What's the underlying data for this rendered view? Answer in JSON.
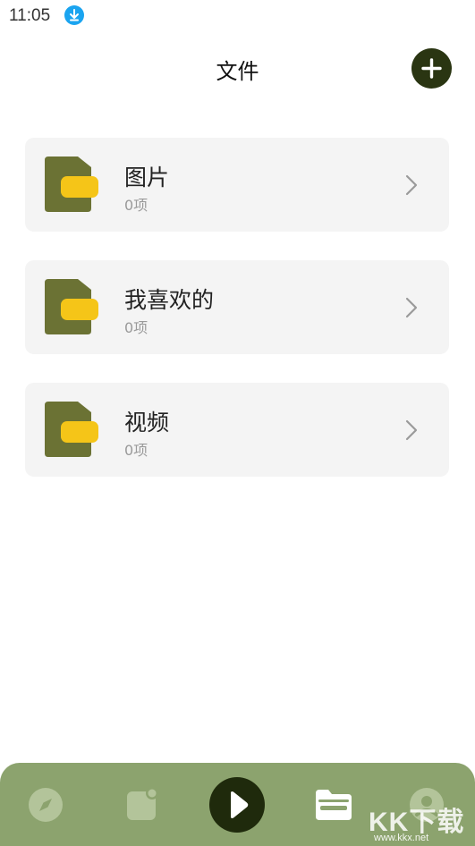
{
  "status_bar": {
    "time": "11:05",
    "download_icon": "download-arrow-icon"
  },
  "header": {
    "title": "文件",
    "add_icon": "plus-icon"
  },
  "folders": [
    {
      "name": "图片",
      "count": "0项",
      "icon": "folder-icon"
    },
    {
      "name": "我喜欢的",
      "count": "0项",
      "icon": "folder-icon"
    },
    {
      "name": "视频",
      "count": "0项",
      "icon": "folder-icon"
    }
  ],
  "bottom_nav": {
    "items": [
      "compass-icon",
      "photo-icon",
      "play-icon",
      "folder-icon",
      "profile-icon"
    ],
    "active": "folder-icon"
  },
  "watermark": {
    "title": "KK下载",
    "url": "www.kkx.net"
  },
  "colors": {
    "folder_dark": "#6b7234",
    "folder_accent": "#f5c518",
    "card_bg": "#f4f4f4",
    "nav_bg": "#8ca36e",
    "primary_dark": "#2a3512",
    "status_accent": "#1aa4f0"
  }
}
